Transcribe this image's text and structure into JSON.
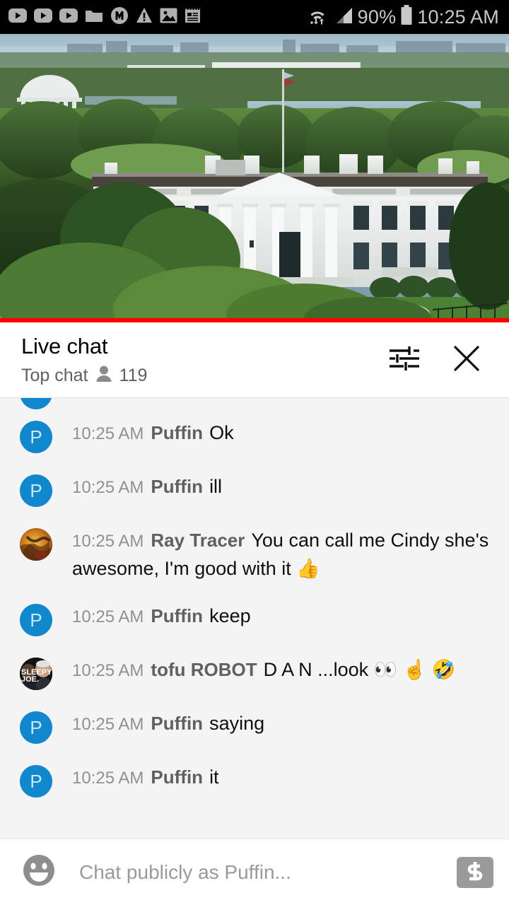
{
  "status_bar": {
    "icons": [
      "youtube-icon",
      "youtube-icon",
      "youtube-icon",
      "folder-icon",
      "m-circle-icon",
      "warning-triangle-icon",
      "image-icon",
      "notes-icon"
    ],
    "wifi_icon": "wifi-icon",
    "signal_icon": "cell-signal-icon",
    "battery_percent": "90%",
    "battery_icon": "battery-icon",
    "time": "10:25 AM"
  },
  "video": {
    "name": "white-house-live-stream",
    "description": "Aerial view of the White House with flagpole, trees and the Jefferson Memorial in the distance",
    "progress_color": "#ff0000"
  },
  "chat_header": {
    "title": "Live chat",
    "mode": "Top chat",
    "viewer_icon": "person-icon",
    "viewer_count": "119",
    "settings_icon": "tune-sliders-icon",
    "close_icon": "close-x-icon"
  },
  "messages": [
    {
      "id": "m0",
      "partial": true,
      "avatar_type": "initial",
      "initial": "",
      "avatar_color": "#1187cd",
      "timestamp": "",
      "author": "",
      "text": ""
    },
    {
      "id": "m1",
      "avatar_type": "initial",
      "initial": "P",
      "avatar_color": "#1187cd",
      "timestamp": "10:25 AM",
      "author": "Puffin",
      "text": "Ok"
    },
    {
      "id": "m2",
      "avatar_type": "initial",
      "initial": "P",
      "avatar_color": "#1187cd",
      "timestamp": "10:25 AM",
      "author": "Puffin",
      "text": "ill"
    },
    {
      "id": "m3",
      "avatar_type": "photo-ray",
      "initial": "",
      "avatar_color": "#c8761f",
      "timestamp": "10:25 AM",
      "author": "Ray Tracer",
      "text": "You can call me Cindy she's awesome, I'm good with it 👍"
    },
    {
      "id": "m4",
      "avatar_type": "initial",
      "initial": "P",
      "avatar_color": "#1187cd",
      "timestamp": "10:25 AM",
      "author": "Puffin",
      "text": "keep"
    },
    {
      "id": "m5",
      "avatar_type": "photo-tofu",
      "initial": "",
      "avatar_color": "#2a2320",
      "timestamp": "10:25 AM",
      "author": "tofu ROBOT",
      "text": "D A N ...look 👀 ☝️ 🤣"
    },
    {
      "id": "m6",
      "avatar_type": "initial",
      "initial": "P",
      "avatar_color": "#1187cd",
      "timestamp": "10:25 AM",
      "author": "Puffin",
      "text": "saying"
    },
    {
      "id": "m7",
      "avatar_type": "initial",
      "initial": "P",
      "avatar_color": "#1187cd",
      "timestamp": "10:25 AM",
      "author": "Puffin",
      "text": "it"
    }
  ],
  "input_bar": {
    "emoji_icon": "emoji-smiley-icon",
    "placeholder": "Chat publicly as Puffin...",
    "value": "",
    "superchat_icon": "dollar-sign-icon"
  },
  "colors": {
    "accent_red": "#ff0000",
    "avatar_blue": "#1187cd",
    "chat_bg": "#f4f4f4",
    "author_gray": "#606060",
    "timestamp_gray": "#909090"
  }
}
